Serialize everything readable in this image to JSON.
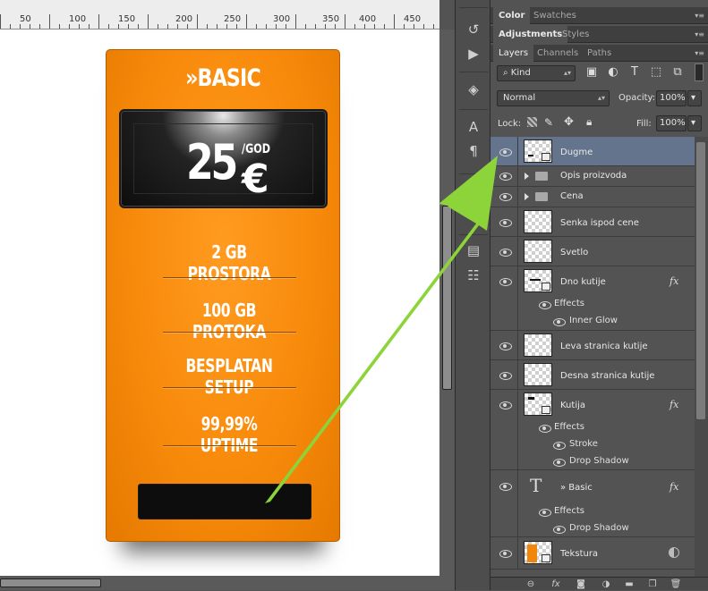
{
  "ruler": {
    "labels": [
      "50",
      "100",
      "150",
      "200",
      "250",
      "300",
      "350",
      "400",
      "450"
    ]
  },
  "card": {
    "title": "»BASIC",
    "price": "25",
    "currency": "€",
    "per": "/GOD",
    "features": [
      "2 GB PROSTORA",
      "100 GB PROTOKA",
      "BESPLATAN SETUP",
      "99,99% UPTIME"
    ]
  },
  "colors": {
    "card_orange": "#f88a0b",
    "arrow_green": "#8cd43a",
    "selected_row": "#63748c"
  },
  "toolstrip": {
    "icons": [
      "history-icon",
      "play-action-icon",
      "3d-icon",
      "character-icon",
      "paragraph-icon",
      "paragraph-styles-icon",
      "character-styles-icon",
      "notes-icon",
      "properties-icon"
    ]
  },
  "panels": {
    "top_tabs": [
      "Color",
      "Swatches"
    ],
    "adj_tabs": [
      "Adjustments",
      "Styles"
    ],
    "layer_tabs": [
      "Layers",
      "Channels",
      "Paths"
    ],
    "kind_filter": "Kind",
    "blend_mode": "Normal",
    "opacity_label": "Opacity:",
    "opacity_value": "100%",
    "lock_label": "Lock:",
    "fill_label": "Fill:",
    "fill_value": "100%"
  },
  "layers": [
    {
      "name": "Dugme",
      "selected": true
    },
    {
      "name": "Opis proizvoda",
      "group": true
    },
    {
      "name": "Cena",
      "group": true
    },
    {
      "name": "Senka ispod cene"
    },
    {
      "name": "Svetlo"
    },
    {
      "name": "Dno kutije",
      "fx": true,
      "effects_label": "Effects",
      "effects": [
        "Inner Glow"
      ]
    },
    {
      "name": "Leva stranica kutije"
    },
    {
      "name": "Desna stranica kutije"
    },
    {
      "name": "Kutija",
      "fx": true,
      "effects_label": "Effects",
      "effects": [
        "Stroke",
        "Drop Shadow"
      ]
    },
    {
      "name": "» Basic",
      "type": "text",
      "fx": true,
      "effects_label": "Effects",
      "effects": [
        "Drop Shadow"
      ]
    },
    {
      "name": "Tekstura",
      "smart": true
    }
  ],
  "fx_label": "fx",
  "footer_icons": [
    "link-layers-icon",
    "add-style-icon",
    "add-mask-icon",
    "adjustment-layer-icon",
    "new-group-icon",
    "new-layer-icon",
    "delete-layer-icon"
  ]
}
